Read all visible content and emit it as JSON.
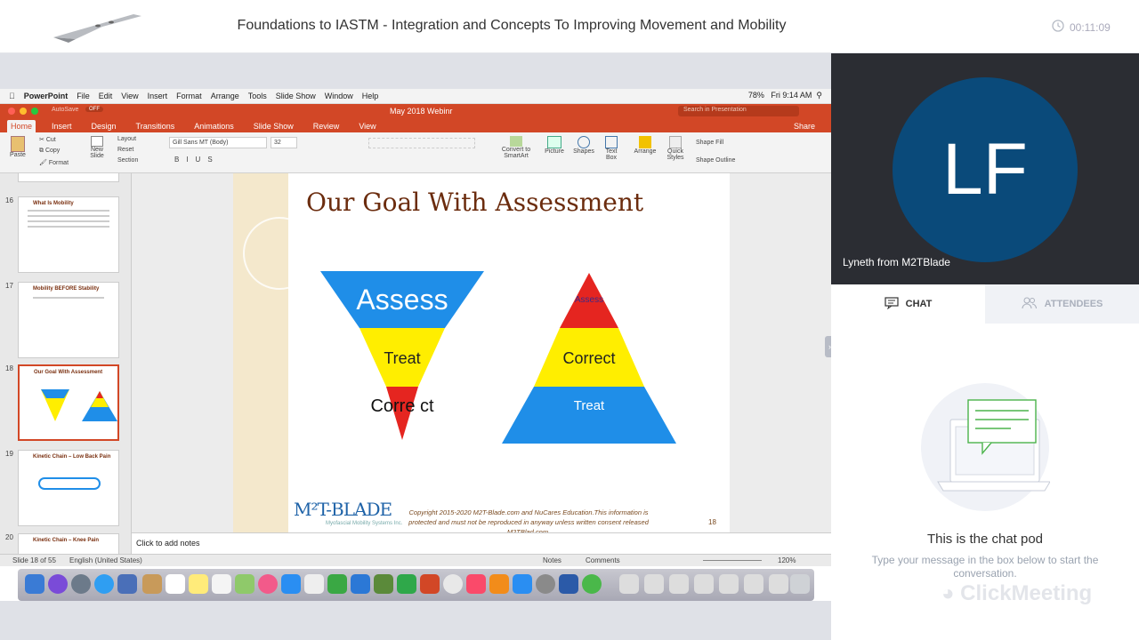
{
  "header": {
    "title": "Foundations to IASTM - Integration and Concepts To Improving Movement and Mobility",
    "timer": "00:11:09"
  },
  "mac_menu": {
    "app": "PowerPoint",
    "items": [
      "File",
      "Edit",
      "View",
      "Insert",
      "Format",
      "Arrange",
      "Tools",
      "Slide Show",
      "Window",
      "Help"
    ],
    "battery": "78%",
    "clock": "Fri 9:14 AM"
  },
  "ppt": {
    "autosave": "AutoSave",
    "autosave_state": "OFF",
    "doc_title": "May 2018 Webinr",
    "search_placeholder": "Search in Presentation",
    "share": "Share",
    "tabs": [
      "Home",
      "Insert",
      "Design",
      "Transitions",
      "Animations",
      "Slide Show",
      "Review",
      "View"
    ],
    "ribbon": {
      "paste": "Paste",
      "cut": "Cut",
      "copy": "Copy",
      "format": "Format",
      "new_slide": "New Slide",
      "layout": "Layout",
      "reset": "Reset",
      "section": "Section",
      "font": "Gill Sans MT (Body)",
      "size": "32",
      "convert": "Convert to SmartArt",
      "picture": "Picture",
      "shapes": "Shapes",
      "textbox": "Text Box",
      "arrange": "Arrange",
      "quick_styles": "Quick Styles",
      "shape_fill": "Shape Fill",
      "shape_outline": "Shape Outline"
    },
    "thumbs": [
      {
        "num": "16",
        "title": "What Is Mobility"
      },
      {
        "num": "17",
        "title": "Mobility BEFORE Stability"
      },
      {
        "num": "18",
        "title": "Our Goal With Assessment"
      },
      {
        "num": "19",
        "title": "Kinetic Chain – Low Back Pain"
      },
      {
        "num": "20",
        "title": "Kinetic Chain – Knee Pain"
      }
    ],
    "slide": {
      "title": "Our Goal With Assessment",
      "left_pyramid": [
        "Assess",
        "Treat",
        "Corre ct"
      ],
      "right_pyramid": [
        "Assess",
        "Correct",
        "Treat"
      ],
      "logo": "M²T-BLADE",
      "logo_sub": "Myofascial Mobility Systems Inc.",
      "copyright": "Copyright 2015-2020 M2T-Blade.com and NuCares Education.This information is protected and must not be reproduced in anyway unless written consent released M2TBlad.com.",
      "page_num": "18",
      "colors": {
        "blue": "#1f8ee8",
        "yellow": "#ffee00",
        "red": "#e52520"
      }
    },
    "notes_placeholder": "Click to add notes",
    "status": {
      "slide": "Slide 18 of 55",
      "lang": "English (United States)",
      "notes": "Notes",
      "comments": "Comments",
      "zoom": "120%"
    }
  },
  "video": {
    "initials": "LF",
    "name": "Lyneth from M2TBlade",
    "avatar_color": "#0a4a7a"
  },
  "tabs": {
    "chat": "CHAT",
    "attendees": "ATTENDEES"
  },
  "chat": {
    "title": "This is the chat pod",
    "subtitle": "Type your message in the box below to start the conversation.",
    "brand": "ClickMeeting"
  }
}
